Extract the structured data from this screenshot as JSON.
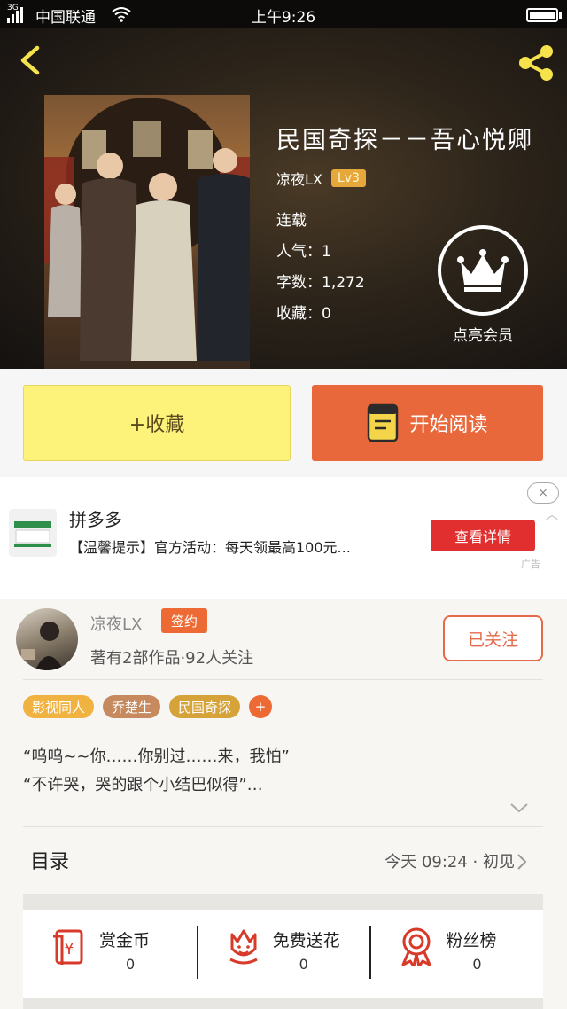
{
  "status_bar": {
    "network": "3G",
    "carrier": "中国联通",
    "time": "上午9:26"
  },
  "book": {
    "title": "民国奇探－－吾心悦卿",
    "author": "凉夜LX",
    "level": "Lv3",
    "status": "连载",
    "popularity_label": "人气：",
    "popularity": "1",
    "word_count_label": "字数：",
    "word_count": "1,272",
    "favorites_label": "收藏：",
    "favorites": "0",
    "vip_label": "点亮会员"
  },
  "actions": {
    "collect_label": "+收藏",
    "read_label": "开始阅读"
  },
  "ad": {
    "title": "拼多多",
    "description": "【温馨提示】官方活动：每天领最高100元...",
    "button_label": "查看详情",
    "close_icon": "×",
    "tag": "广告"
  },
  "author_card": {
    "name": "凉夜LX",
    "sign_badge": "签约",
    "stats": "著有2部作品·92人关注",
    "follow_label": "已关注",
    "tags": [
      {
        "label": "影视同人",
        "color": "#f0b240"
      },
      {
        "label": "乔楚生",
        "color": "#c68a5e"
      },
      {
        "label": "民国奇探",
        "color": "#d6a33a"
      },
      {
        "label": "+",
        "color": "#ee6a34"
      }
    ],
    "intro_lines": [
      "“呜呜~~你……你别过……来，我怕”",
      "“不许哭，哭的跟个小结巴似得”…"
    ]
  },
  "toc": {
    "label": "目录",
    "update": "今天 09:24 · 初见"
  },
  "rewards": [
    {
      "label": "赏金币",
      "count": "0",
      "icon": "red-envelope-icon"
    },
    {
      "label": "免费送花",
      "count": "0",
      "icon": "flower-icon"
    },
    {
      "label": "粉丝榜",
      "count": "0",
      "icon": "medal-icon"
    }
  ],
  "colors": {
    "accent_orange": "#e8683c",
    "collect_yellow": "#fdf27a",
    "ad_red": "#e12f2f",
    "icon_red": "#d83a2a"
  }
}
